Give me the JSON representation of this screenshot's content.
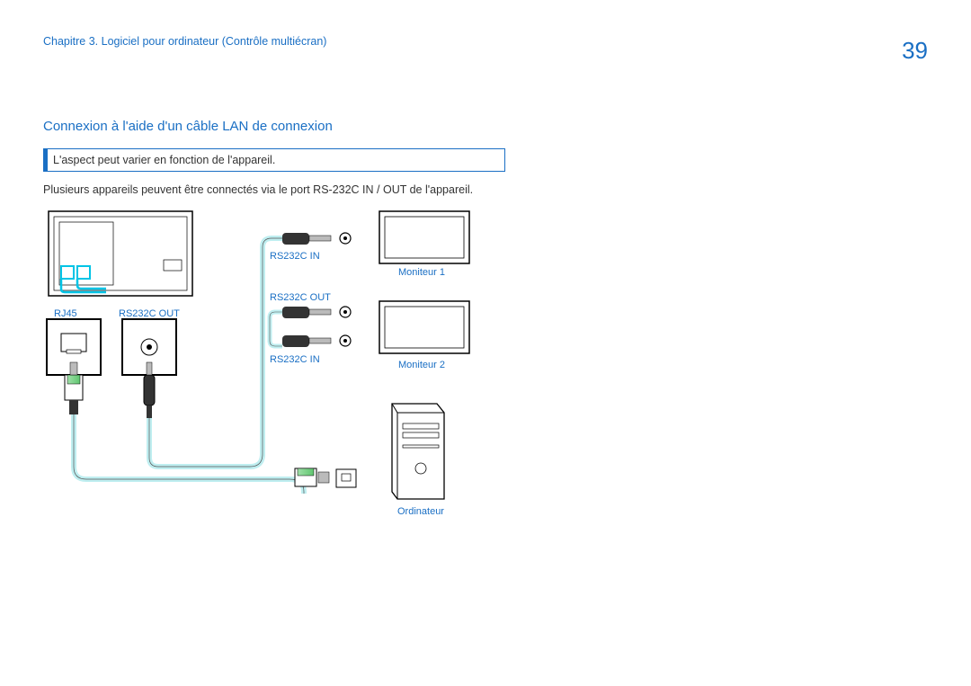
{
  "header": {
    "chapter": "Chapitre 3. Logiciel pour ordinateur (Contrôle multiécran)",
    "page_number": "39"
  },
  "section": {
    "title": "Connexion à l'aide d'un câble LAN de connexion",
    "note": "L'aspect peut varier en fonction de l'appareil.",
    "body": "Plusieurs appareils peuvent être connectés via le port RS-232C IN / OUT de l'appareil."
  },
  "diagram_labels": {
    "rj45": "RJ45",
    "rs232c_out_left": "RS232C OUT",
    "rs232c_in_top": "RS232C IN",
    "rs232c_out_mid": "RS232C OUT",
    "rs232c_in_bottom": "RS232C IN",
    "monitor1": "Moniteur 1",
    "monitor2": "Moniteur 2",
    "computer": "Ordinateur"
  }
}
